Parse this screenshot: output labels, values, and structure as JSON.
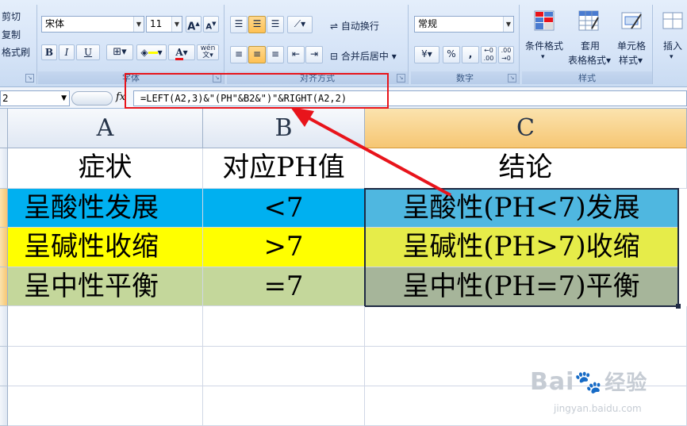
{
  "ribbon": {
    "clipboard": {
      "cut": "剪切",
      "copy": "复制",
      "format_painter": "格式刷"
    },
    "font": {
      "group_label": "字体",
      "font_name": "宋体",
      "font_size": "11",
      "bold": "B",
      "italic": "I",
      "underline": "U",
      "grow": "A",
      "shrink": "A",
      "phonetic": "wén"
    },
    "alignment": {
      "group_label": "对齐方式",
      "wrap_text": "自动换行",
      "merge_center": "合并后居中"
    },
    "number": {
      "group_label": "数字",
      "format": "常规",
      "percent": "%",
      "comma": ",",
      "inc_decimal": ".00",
      "dec_decimal": ".00"
    },
    "styles": {
      "group_label": "样式",
      "conditional_l1": "条件格式",
      "table_l1": "套用",
      "table_l2": "表格格式",
      "cell_l1": "单元格",
      "cell_l2": "样式"
    },
    "cells": {
      "insert": "插入"
    }
  },
  "formula_bar": {
    "name_box": "2",
    "fx": "fx",
    "formula": "=LEFT(A2,3)&\"(PH\"&B2&\")\"&RIGHT(A2,2)"
  },
  "columns": [
    "A",
    "B",
    "C"
  ],
  "rows": [
    {
      "a": "症状",
      "b": "对应PH值",
      "c": "结论"
    },
    {
      "a": "呈酸性发展",
      "b": "<7",
      "c": "呈酸性(PH<7)发展"
    },
    {
      "a": "呈碱性收缩",
      "b": ">7",
      "c": "呈碱性(PH>7)收缩"
    },
    {
      "a": "呈中性平衡",
      "b": "=7",
      "c": "呈中性(PH=7)平衡"
    }
  ],
  "colors": {
    "acid_fill": "#00b0f0",
    "base_fill": "#ffff00",
    "neutral_fill": "#c4d79b",
    "conclusion_acid": "#4fb7e0",
    "conclusion_base": "#e6ec49",
    "conclusion_neutral": "#a6b59a",
    "annotation_red": "#e8141b",
    "selected_col": "#f6c673"
  },
  "watermark": {
    "brand": "Bai",
    "mark": "经验",
    "url": "jingyan.baidu.com"
  }
}
